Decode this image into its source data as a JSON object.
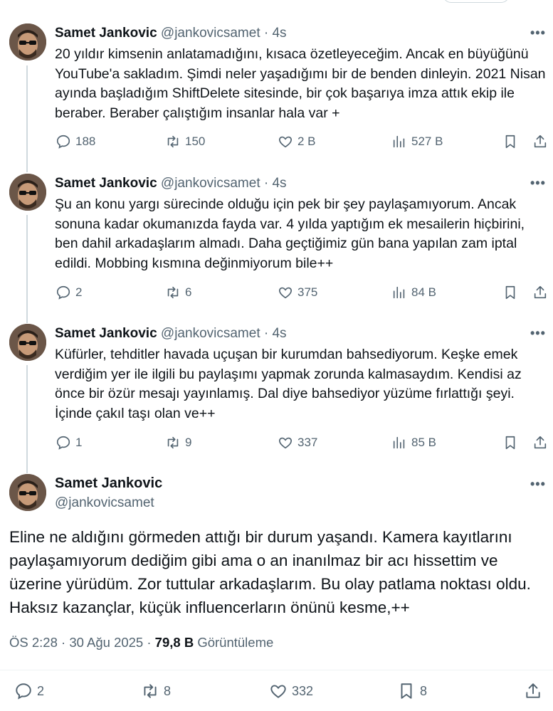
{
  "tweets": [
    {
      "name": "Samet Jankovic",
      "handle": "@jankovicsamet",
      "time": "4s",
      "text": "20 yıldır kimsenin anlatamadığını, kısaca özetleyeceğim. Ancak en büyüğünü YouTube'a sakladım. Şimdi neler yaşadığımı bir de benden dinleyin. 2021 Nisan ayında başladığım ShiftDelete sitesinde, bir çok başarıya imza attık ekip ile beraber. Beraber çalıştığım insanlar hala var +",
      "replies": "188",
      "reposts": "150",
      "likes": "2 B",
      "views": "527 B"
    },
    {
      "name": "Samet Jankovic",
      "handle": "@jankovicsamet",
      "time": "4s",
      "text": "Şu an konu yargı sürecinde olduğu için pek bir şey paylaşamıyorum. Ancak sonuna kadar okumanızda fayda var. 4 yılda yaptığım ek mesailerin hiçbirini, ben dahil arkadaşlarım almadı. Daha geçtiğimiz gün bana yapılan zam iptal edildi. Mobbing kısmına değinmiyorum bile++",
      "replies": "2",
      "reposts": "6",
      "likes": "375",
      "views": "84 B"
    },
    {
      "name": "Samet Jankovic",
      "handle": "@jankovicsamet",
      "time": "4s",
      "text": "Küfürler, tehditler havada uçuşan bir kurumdan bahsediyorum. Keşke emek verdiğim yer ile ilgili bu paylaşımı yapmak zorunda kalmasaydım. Kendisi az önce bir özür mesajı yayınlamış. Dal diye bahsediyor yüzüme fırlattığı şeyi. İçinde çakıl taşı olan ve++",
      "replies": "1",
      "reposts": "9",
      "likes": "337",
      "views": "85 B"
    }
  ],
  "main": {
    "name": "Samet Jankovic",
    "handle": "@jankovicsamet",
    "text": "Eline ne aldığını görmeden attığı bir durum yaşandı. Kamera kayıtlarını paylaşamıyorum dediğim gibi ama o an inanılmaz bir acı hissettim ve üzerine yürüdüm. Zor tuttular arkadaşlarım. Bu olay patlama noktası oldu. Haksız kazançlar, küçük influencerların önünü kesme,++",
    "timestamp": "ÖS 2:28 · 30 Ağu 2025 · ",
    "views_count": "79,8 B",
    "views_label": "Görüntüleme",
    "replies": "2",
    "reposts": "8",
    "likes": "332",
    "bookmarks": "8"
  },
  "icons": {
    "reply": "reply-icon",
    "repost": "repost-icon",
    "like": "heart-icon",
    "views": "views-icon",
    "bookmark": "bookmark-icon",
    "share": "share-icon",
    "more": "more-icon"
  },
  "colors": {
    "text": "#0f1419",
    "secondary": "#536471",
    "line": "#cfd9de"
  }
}
